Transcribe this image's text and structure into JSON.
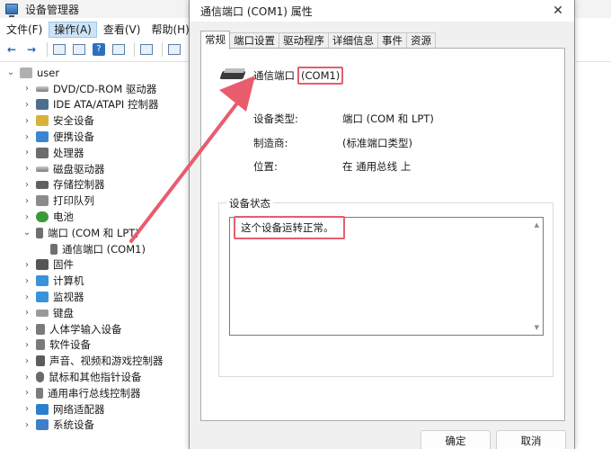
{
  "device_manager": {
    "title": "设备管理器",
    "menu": [
      "文件(F)",
      "操作(A)",
      "查看(V)",
      "帮助(H)"
    ],
    "tree": {
      "root": "user",
      "categories": [
        {
          "label": "DVD/CD-ROM 驱动器",
          "icon": "disk-drive-icon",
          "expanded": false
        },
        {
          "label": "IDE ATA/ATAPI 控制器",
          "icon": "ide-controller-icon",
          "expanded": false
        },
        {
          "label": "安全设备",
          "icon": "key-icon",
          "expanded": false
        },
        {
          "label": "便携设备",
          "icon": "portable-device-icon",
          "expanded": false
        },
        {
          "label": "处理器",
          "icon": "processor-icon",
          "expanded": false
        },
        {
          "label": "磁盘驱动器",
          "icon": "hard-disk-icon",
          "expanded": false
        },
        {
          "label": "存储控制器",
          "icon": "storage-controller-icon",
          "expanded": false
        },
        {
          "label": "打印队列",
          "icon": "printer-icon",
          "expanded": false
        },
        {
          "label": "电池",
          "icon": "battery-icon",
          "expanded": false
        },
        {
          "label": "端口 (COM 和 LPT)",
          "icon": "port-connector-icon",
          "expanded": true,
          "children": [
            "通信端口 (COM1)"
          ]
        },
        {
          "label": "固件",
          "icon": "firmware-chip-icon",
          "expanded": false
        },
        {
          "label": "计算机",
          "icon": "computer-icon",
          "expanded": false
        },
        {
          "label": "监视器",
          "icon": "monitor-icon",
          "expanded": false
        },
        {
          "label": "键盘",
          "icon": "keyboard-icon",
          "expanded": false
        },
        {
          "label": "人体学输入设备",
          "icon": "hid-icon",
          "expanded": false
        },
        {
          "label": "软件设备",
          "icon": "software-device-icon",
          "expanded": false
        },
        {
          "label": "声音、视频和游戏控制器",
          "icon": "sound-icon",
          "expanded": false
        },
        {
          "label": "鼠标和其他指针设备",
          "icon": "mouse-icon",
          "expanded": false
        },
        {
          "label": "通用串行总线控制器",
          "icon": "usb-icon",
          "expanded": false
        },
        {
          "label": "网络适配器",
          "icon": "network-adapter-icon",
          "expanded": false
        },
        {
          "label": "系统设备",
          "icon": "system-device-icon",
          "expanded": false
        }
      ]
    }
  },
  "dialog": {
    "title": "通信端口 (COM1) 属性",
    "tabs": [
      "常规",
      "端口设置",
      "驱动程序",
      "详细信息",
      "事件",
      "资源"
    ],
    "active_tab": "常规",
    "device_name_prefix": "通信端口",
    "device_name_highlight": "(COM1)",
    "properties": [
      {
        "key": "设备类型:",
        "value": "端口 (COM 和 LPT)"
      },
      {
        "key": "制造商:",
        "value": "(标准端口类型)"
      },
      {
        "key": "位置:",
        "value": "在 通用总线 上"
      }
    ],
    "status_label": "设备状态",
    "status_text": "这个设备运转正常。",
    "ok_label": "确定",
    "cancel_label": "取消"
  },
  "annotation": {
    "highlight_color": "#e85c6e"
  }
}
